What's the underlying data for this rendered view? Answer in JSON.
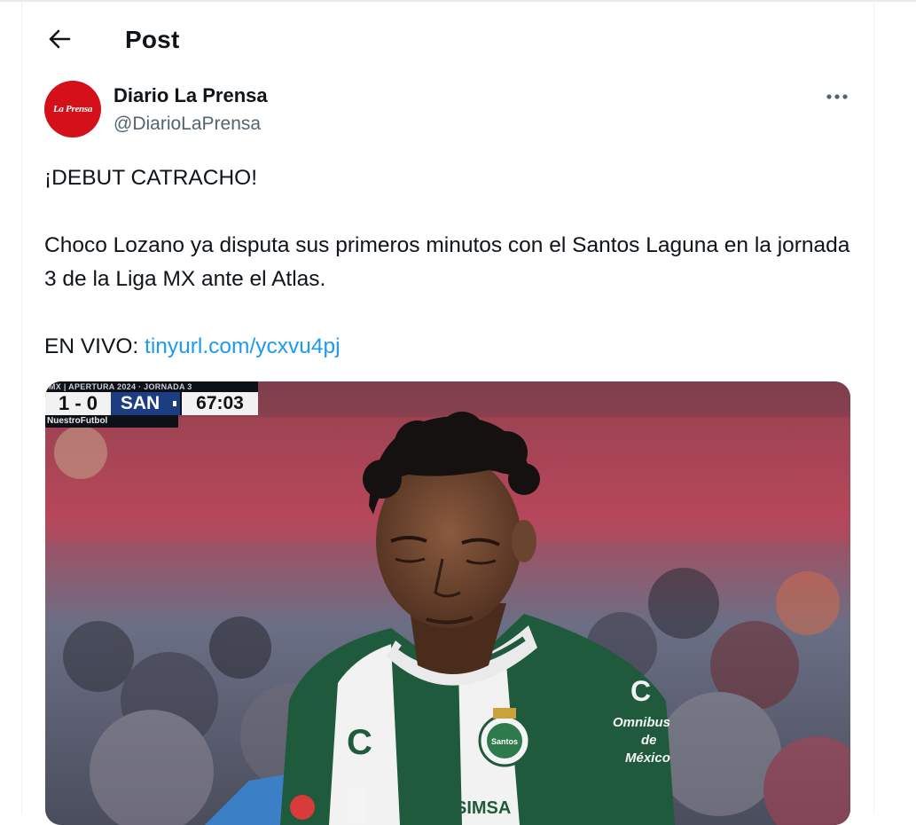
{
  "header": {
    "title": "Post",
    "back_icon": "arrow-left-icon"
  },
  "author": {
    "display_name": "Diario La Prensa",
    "handle": "@DiarioLaPrensa",
    "avatar_text": "La Prensa",
    "avatar_color": "#d4111b",
    "more_icon": "more-horizontal-icon"
  },
  "tweet": {
    "line1": "¡DEBUT CATRACHO!",
    "line2": "Choco Lozano ya disputa sus primeros minutos con el Santos Laguna en la jornada 3 de la Liga MX ante el Atlas.",
    "live_prefix": "EN VIVO: ",
    "link_text": "tinyurl.com/ycxvu4pj",
    "link_color": "#1d9bf0"
  },
  "media": {
    "scorebug": {
      "header": "MX | APERTURA 2024 · JORNADA 3",
      "score": "1 - 0",
      "team": "SAN",
      "clock": "67:03",
      "broadcaster": "NuestroFutbol"
    },
    "jersey": {
      "sponsor": "SIMSA",
      "right_sponsor_1": "Omnibus",
      "right_sponsor_2": "de",
      "right_sponsor_3": "México",
      "crest_text": "Santos"
    }
  }
}
